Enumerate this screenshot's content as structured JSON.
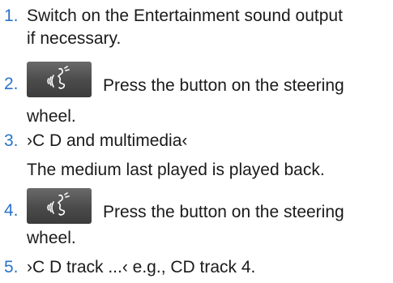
{
  "colors": {
    "step_number": "#2a73c8",
    "text": "#1a1a1a",
    "button_bg": "#4a4a4a",
    "button_icon": "#ffffff"
  },
  "icons": {
    "voice_button": "voice-control-icon"
  },
  "steps": [
    {
      "number": "1.",
      "text_line1": "Switch on the Entertainment sound output",
      "text_line2": "if necessary."
    },
    {
      "number": "2.",
      "text_line1": "Press the button on the steering",
      "text_line2": "wheel."
    },
    {
      "number": "3.",
      "text_line1": "›C D and multimedia‹",
      "note": "The medium last played is played back."
    },
    {
      "number": "4.",
      "text_line1": "Press the button on the steering",
      "text_line2": "wheel."
    },
    {
      "number": "5.",
      "text_line1": "›C D track ...‹ e.g., CD track 4."
    }
  ]
}
